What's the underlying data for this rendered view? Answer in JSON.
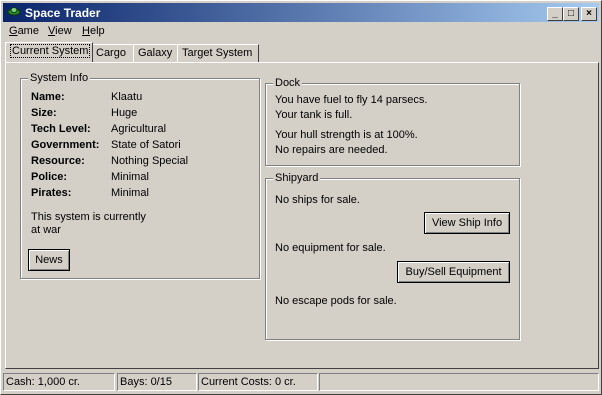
{
  "window": {
    "title": "Space Trader",
    "buttons": {
      "minimize": "_",
      "maximize": "□",
      "close": "×"
    }
  },
  "menu": {
    "game": {
      "first": "G",
      "rest": "ame"
    },
    "view": {
      "first": "V",
      "rest": "iew"
    },
    "help": {
      "first": "H",
      "rest": "elp"
    }
  },
  "tabs": [
    "Current System",
    "Cargo",
    "Galaxy",
    "Target System"
  ],
  "system_info": {
    "title": "System Info",
    "rows": [
      {
        "label": "Name:",
        "value": "Klaatu"
      },
      {
        "label": "Size:",
        "value": "Huge"
      },
      {
        "label": "Tech Level:",
        "value": "Agricultural"
      },
      {
        "label": "Government:",
        "value": "State of Satori"
      },
      {
        "label": "Resource:",
        "value": "Nothing Special"
      },
      {
        "label": "Police:",
        "value": "Minimal"
      },
      {
        "label": "Pirates:",
        "value": "Minimal"
      }
    ],
    "status_line1": "This system is currently",
    "status_line2": "at war",
    "news_button": "News"
  },
  "dock": {
    "title": "Dock",
    "fuel": "You have fuel to fly 14 parsecs.",
    "tank": "Your tank is full.",
    "hull": "Your hull strength is at 100%.",
    "repairs": "No repairs are needed."
  },
  "shipyard": {
    "title": "Shipyard",
    "ships": "No ships for sale.",
    "view_ship_button": "View Ship Info",
    "equipment": "No equipment for sale.",
    "equipment_button": "Buy/Sell Equipment",
    "pods": "No escape pods for sale."
  },
  "status": {
    "cash": "Cash: 1,000 cr.",
    "bays": "Bays: 0/15",
    "costs": "Current Costs: 0 cr."
  }
}
